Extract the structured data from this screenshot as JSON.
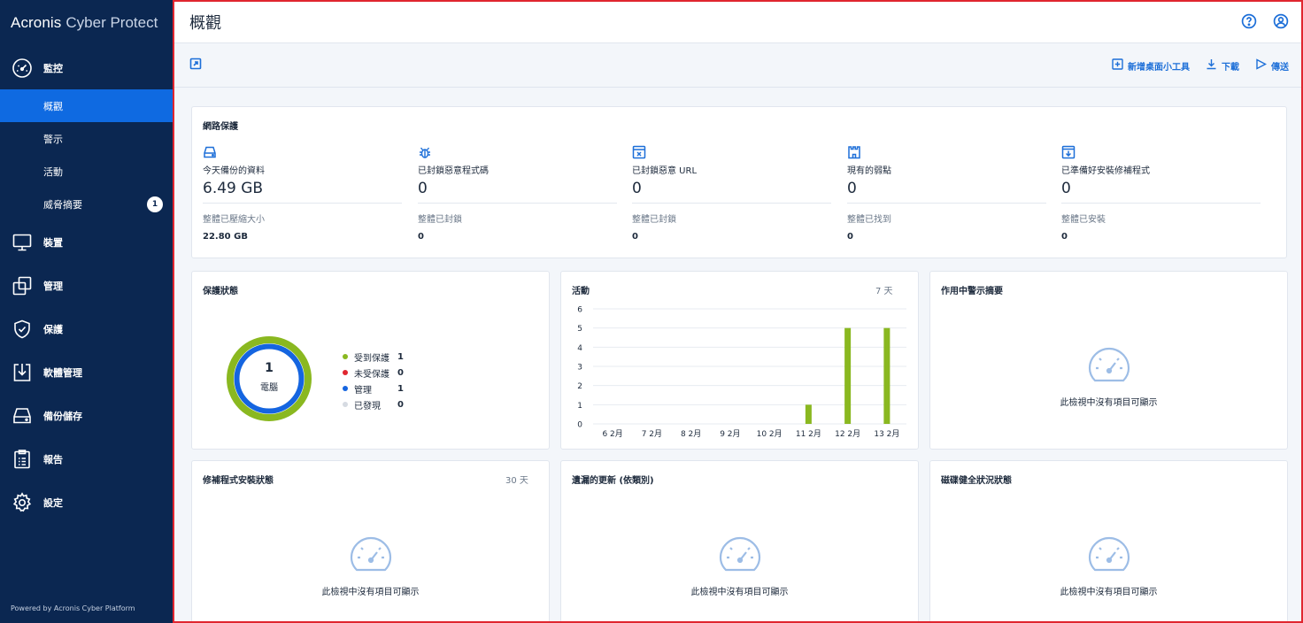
{
  "sidebar": {
    "brand_primary": "Acronis",
    "brand_secondary": "Cyber Protect",
    "sections": [
      {
        "label": "監控",
        "icon": "gauge-icon"
      },
      {
        "label": "裝置",
        "icon": "monitor-icon"
      },
      {
        "label": "管理",
        "icon": "manage-icon"
      },
      {
        "label": "保護",
        "icon": "shield-icon"
      },
      {
        "label": "軟體管理",
        "icon": "software-icon"
      },
      {
        "label": "備份儲存",
        "icon": "storage-icon"
      },
      {
        "label": "報告",
        "icon": "report-icon"
      },
      {
        "label": "設定",
        "icon": "gear-icon"
      }
    ],
    "sub_items": [
      {
        "label": "概觀",
        "active": true
      },
      {
        "label": "警示"
      },
      {
        "label": "活動"
      },
      {
        "label": "威脅摘要",
        "badge": "1"
      }
    ],
    "powered_by": "Powered by Acronis Cyber Platform"
  },
  "header": {
    "title": "概觀",
    "icons": [
      "help-icon",
      "account-icon"
    ]
  },
  "toolbar": {
    "add_widget": "新增桌面小工具",
    "download": "下載",
    "send": "傳送"
  },
  "cyber": {
    "title": "網路保護",
    "stats": [
      {
        "icon": "drive-icon",
        "label": "今天備份的資料",
        "value": "6.49 GB",
        "sublabel": "整體已壓縮大小",
        "subvalue": "22.80 GB"
      },
      {
        "icon": "bug-icon",
        "label": "已封鎖惡意程式碼",
        "value": "0",
        "sublabel": "整體已封鎖",
        "subvalue": "0"
      },
      {
        "icon": "blocked-url-icon",
        "label": "已封鎖惡意 URL",
        "value": "0",
        "sublabel": "整體已封鎖",
        "subvalue": "0"
      },
      {
        "icon": "castle-icon",
        "label": "現有的弱點",
        "value": "0",
        "sublabel": "整體已找到",
        "subvalue": "0"
      },
      {
        "icon": "patch-icon",
        "label": "已準備好安裝修補程式",
        "value": "0",
        "sublabel": "整體已安裝",
        "subvalue": "0"
      }
    ]
  },
  "protection": {
    "title": "保護狀態",
    "center_value": "1",
    "center_label": "電腦",
    "legend": [
      {
        "name": "受到保護",
        "value": "1",
        "color": "#8ab820"
      },
      {
        "name": "未受保護",
        "value": "0",
        "color": "#e0262f"
      },
      {
        "name": "管理",
        "value": "1",
        "color": "#1565e0"
      },
      {
        "name": "已發現",
        "value": "0",
        "color": "#d6dbe2"
      }
    ]
  },
  "activity": {
    "title": "活動",
    "range": "7 天"
  },
  "chart_data": {
    "type": "bar",
    "categories": [
      "6 2月",
      "7 2月",
      "8 2月",
      "9 2月",
      "10 2月",
      "11 2月",
      "12 2月",
      "13 2月"
    ],
    "values": [
      0,
      0,
      0,
      0,
      0,
      1,
      5,
      5
    ],
    "yticks": [
      "0",
      "1",
      "2",
      "3",
      "4",
      "5",
      "6"
    ],
    "ylim": [
      0,
      6
    ],
    "bar_color": "#8ab820",
    "grid": true
  },
  "alerts": {
    "title": "作用中警示摘要",
    "empty_text": "此檢視中沒有項目可顯示"
  },
  "patch_status": {
    "title": "修補程式安裝狀態",
    "range": "30 天",
    "empty_text": "此檢視中沒有項目可顯示"
  },
  "missing_updates": {
    "title": "遺漏的更新 (依類別)",
    "empty_text": "此檢視中沒有項目可顯示"
  },
  "disk_health": {
    "title": "磁碟健全狀況狀態",
    "empty_text": "此檢視中沒有項目可顯示"
  }
}
